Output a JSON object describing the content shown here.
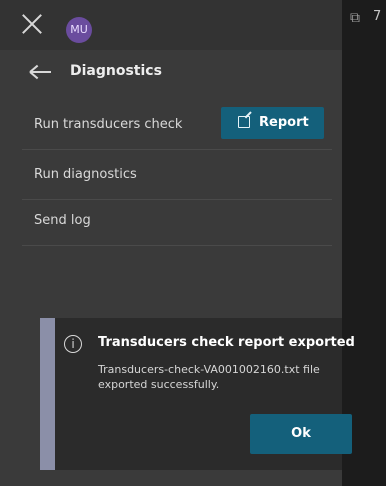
{
  "topbar": {
    "avatar_initials": "MU"
  },
  "header": {
    "title": "Diagnostics"
  },
  "rows": [
    {
      "label": "Run transducers check"
    },
    {
      "label": "Run diagnostics"
    },
    {
      "label": "Send log"
    }
  ],
  "report_button": {
    "label": "Report"
  },
  "toast": {
    "title": "Transducers check report exported",
    "message": "Transducers-check-VA001002160.txt file exported successfully.",
    "ok_label": "Ok"
  },
  "right_strip": {
    "count": "7"
  },
  "colors": {
    "accent": "#14607b",
    "panel": "#3a3a3a",
    "toast_bar": "#8b8fa8",
    "avatar_bg": "#6a4c9e"
  }
}
